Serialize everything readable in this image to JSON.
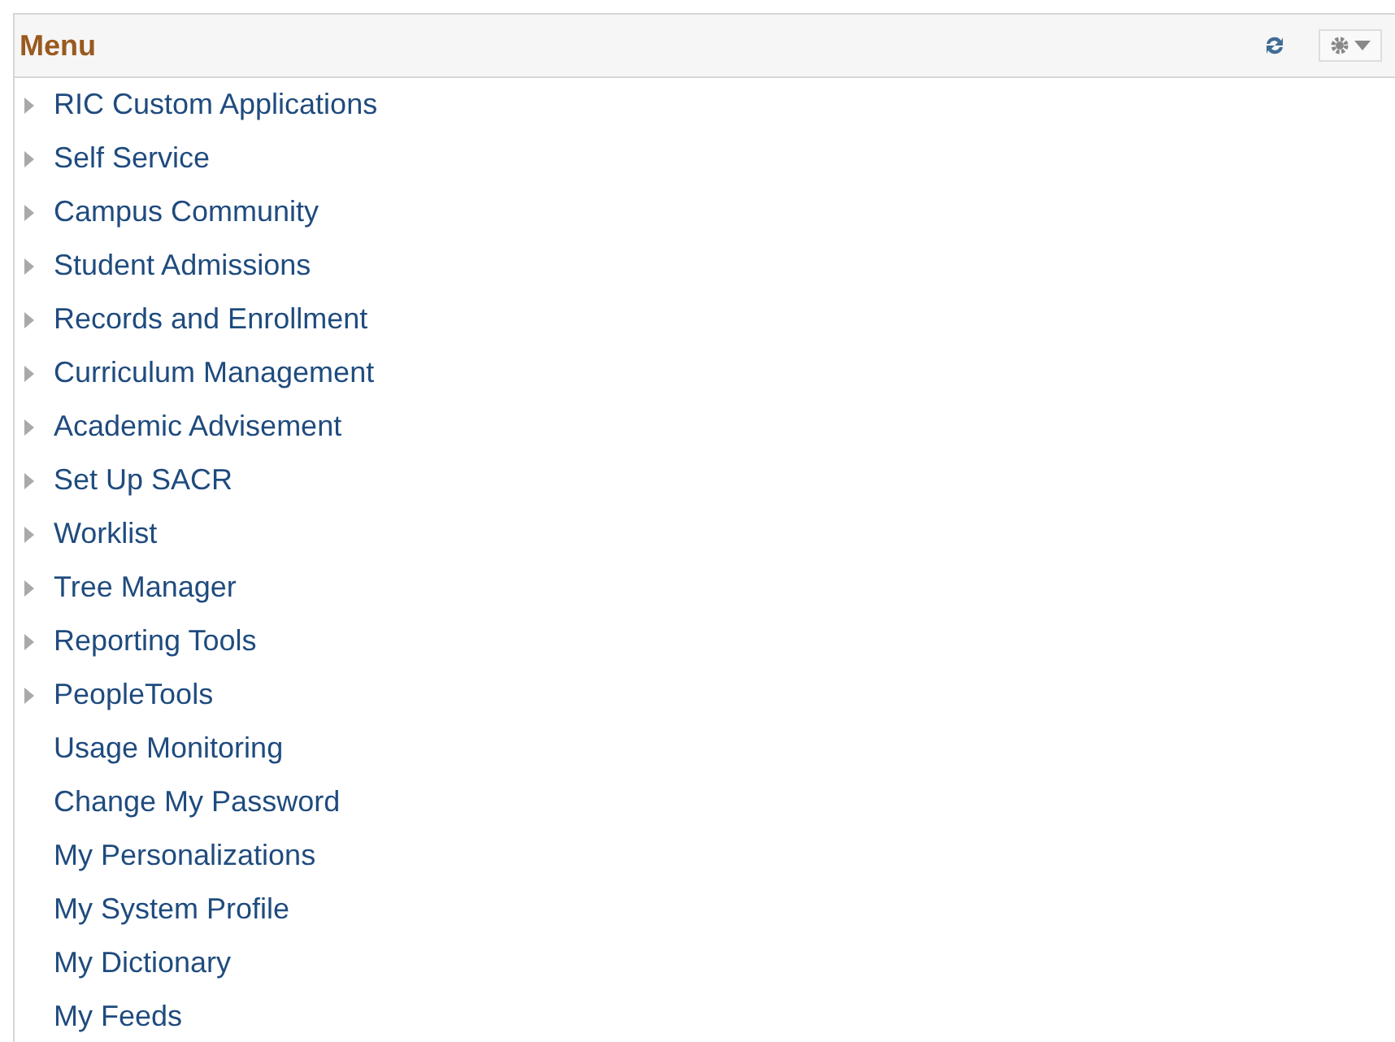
{
  "header": {
    "title": "Menu"
  },
  "items": [
    {
      "label": "RIC Custom Applications",
      "kind": "folder"
    },
    {
      "label": "Self Service",
      "kind": "folder"
    },
    {
      "label": "Campus Community",
      "kind": "folder"
    },
    {
      "label": "Student Admissions",
      "kind": "folder"
    },
    {
      "label": "Records and Enrollment",
      "kind": "folder"
    },
    {
      "label": "Curriculum Management",
      "kind": "folder"
    },
    {
      "label": "Academic Advisement",
      "kind": "folder"
    },
    {
      "label": "Set Up SACR",
      "kind": "folder"
    },
    {
      "label": "Worklist",
      "kind": "folder"
    },
    {
      "label": "Tree Manager",
      "kind": "folder"
    },
    {
      "label": "Reporting Tools",
      "kind": "folder"
    },
    {
      "label": "PeopleTools",
      "kind": "folder"
    },
    {
      "label": "Usage Monitoring",
      "kind": "link"
    },
    {
      "label": "Change My Password",
      "kind": "link"
    },
    {
      "label": "My Personalizations",
      "kind": "link"
    },
    {
      "label": "My System Profile",
      "kind": "link"
    },
    {
      "label": "My Dictionary",
      "kind": "link"
    },
    {
      "label": "My Feeds",
      "kind": "link"
    }
  ]
}
